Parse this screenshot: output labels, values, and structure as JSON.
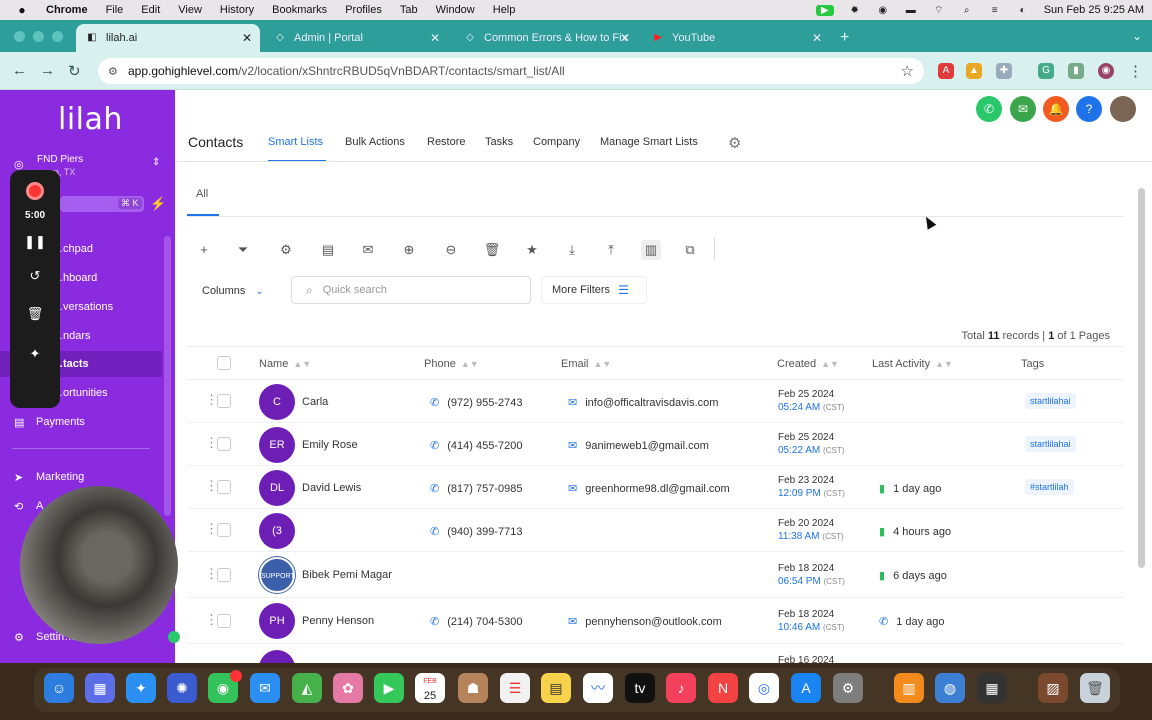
{
  "menubar": {
    "app": "Chrome",
    "items": [
      "File",
      "Edit",
      "View",
      "History",
      "Bookmarks",
      "Profiles",
      "Tab",
      "Window",
      "Help"
    ],
    "clock": "Sun Feb 25  9:25 AM"
  },
  "tabs": [
    {
      "title": "lilah.ai",
      "active": true
    },
    {
      "title": "Admin | Portal",
      "active": false
    },
    {
      "title": "Common Errors & How to Fix",
      "active": false
    },
    {
      "title": "YouTube",
      "active": false
    }
  ],
  "address": {
    "host": "app.gohighlevel.com",
    "path": "/v2/location/xShntrcRBUD5qVnBDART/contacts/smart_list/All"
  },
  "sidebar": {
    "logo": "lilah",
    "account_name": "FND Piers",
    "account_location": "…ora, TX",
    "search_shortcut": "⌘ K",
    "items": [
      {
        "label": "…chpad"
      },
      {
        "label": "…hboard"
      },
      {
        "label": "…versations"
      },
      {
        "label": "…ndars"
      },
      {
        "label": "…tacts",
        "active": true
      },
      {
        "label": "…ortunities"
      },
      {
        "label": "Payments"
      },
      {
        "label": "Marketing"
      },
      {
        "label": "A…"
      },
      {
        "label": "Settin…"
      }
    ]
  },
  "recorder": {
    "time": "5:00"
  },
  "header": {
    "title": "Contacts",
    "tabs": [
      "Smart Lists",
      "Bulk Actions",
      "Restore",
      "Tasks",
      "Company",
      "Manage Smart Lists"
    ]
  },
  "smart_list_tab": "All",
  "toolbar": {
    "columns_label": "Columns",
    "search_placeholder": "Quick search",
    "more_filters_label": "More Filters"
  },
  "records": {
    "prefix": "Total",
    "count": "11",
    "records_word": "records |",
    "page": "1",
    "pages_suffix": "of 1 Pages"
  },
  "table": {
    "columns": [
      "Name",
      "Phone",
      "Email",
      "Created",
      "Last Activity",
      "Tags"
    ],
    "rows": [
      {
        "initials": "C",
        "name": "Carla",
        "phone": "(972) 955-2743",
        "email": "info@officaltravisdavis.com",
        "created_date": "Feb 25 2024",
        "created_time": "05:24 AM",
        "tz": "(CST)",
        "activity": "",
        "tag": "startlilahai"
      },
      {
        "initials": "ER",
        "name": "Emily Rose",
        "phone": "(414) 455-7200",
        "email": "9animeweb1@gmail.com",
        "created_date": "Feb 25 2024",
        "created_time": "05:22 AM",
        "tz": "(CST)",
        "activity": "",
        "tag": "startlilahai"
      },
      {
        "initials": "DL",
        "name": "David Lewis",
        "phone": "(817) 757-0985",
        "email": "greenhorme98.dl@gmail.com",
        "created_date": "Feb 23 2024",
        "created_time": "12:09 PM",
        "tz": "(CST)",
        "activity": "1 day ago",
        "tag": "#startlilah"
      },
      {
        "initials": "(3",
        "name": "",
        "phone": "(940) 399-7713",
        "email": "",
        "created_date": "Feb 20 2024",
        "created_time": "11:38 AM",
        "tz": "(CST)",
        "activity": "4 hours ago",
        "tag": ""
      },
      {
        "initials": "SUPPORT",
        "name": "Bibek Pemi Magar",
        "phone": "",
        "email": "",
        "created_date": "Feb 18 2024",
        "created_time": "06:54 PM",
        "tz": "(CST)",
        "activity": "6 days ago",
        "tag": ""
      },
      {
        "initials": "PH",
        "name": "Penny Henson",
        "phone": "(214) 704-5300",
        "email": "pennyhenson@outlook.com",
        "created_date": "Feb 18 2024",
        "created_time": "10:46 AM",
        "tz": "(CST)",
        "activity": "1 day ago",
        "tag": ""
      },
      {
        "initials": "JB",
        "name": "",
        "phone": "",
        "email": "",
        "created_date": "Feb 16 2024",
        "created_time": "",
        "tz": "",
        "activity": "",
        "tag": ""
      }
    ]
  },
  "dock": {
    "calendar_month": "FEB",
    "calendar_day": "25"
  },
  "colors": {
    "sidebar": "#8b2be0",
    "accent": "#1e73e8",
    "tabbar": "#2e9e9a"
  }
}
